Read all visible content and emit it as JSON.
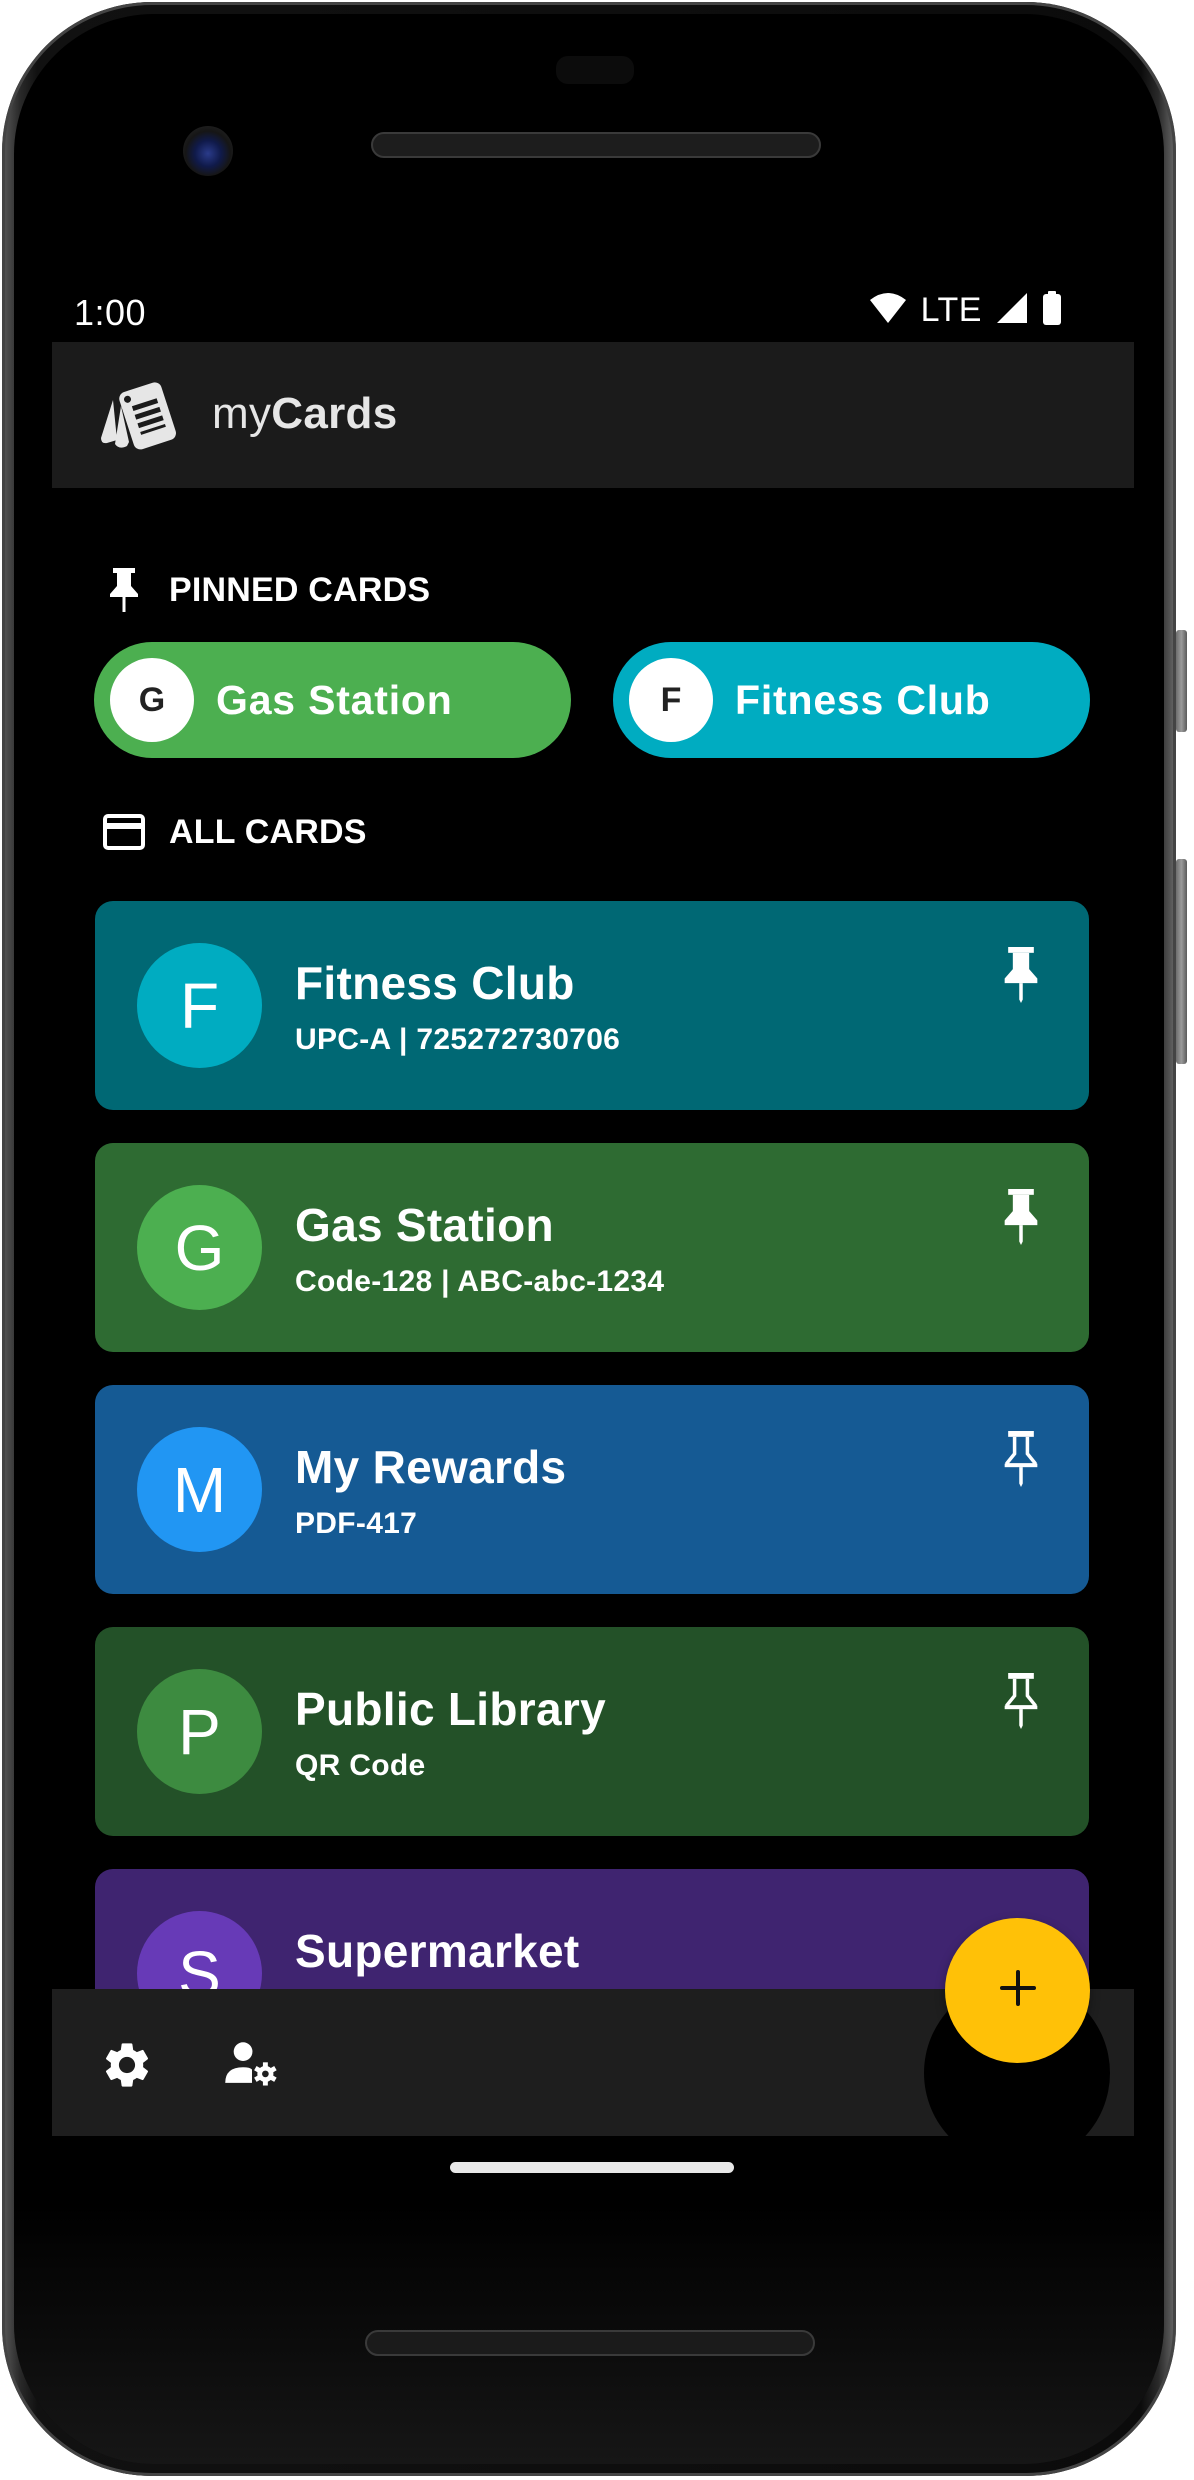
{
  "status_bar": {
    "time": "1:00",
    "network": "LTE",
    "icons": [
      "wifi-icon",
      "cellular-signal-icon",
      "battery-icon"
    ]
  },
  "app_bar": {
    "logo_icon": "cards-logo-icon",
    "title_prefix": "my",
    "title_main": "Cards"
  },
  "pinned_section": {
    "icon": "pin-icon",
    "label": "PINNED CARDS",
    "chips": [
      {
        "initial": "G",
        "label": "Gas Station",
        "color": "#4caf50"
      },
      {
        "initial": "F",
        "label": "Fitness Club",
        "color": "#00acc1"
      }
    ]
  },
  "all_section": {
    "icon": "credit-card-icon",
    "label": "ALL CARDS",
    "cards": [
      {
        "initial": "F",
        "title": "Fitness Club",
        "subtitle": "UPC-A | 725272730706",
        "pinned": true,
        "bg": "#006874",
        "avatar_bg": "#00acc1"
      },
      {
        "initial": "G",
        "title": "Gas Station",
        "subtitle": "Code-128 | ABC-abc-1234",
        "pinned": true,
        "bg": "#2e6b32",
        "avatar_bg": "#4caf50"
      },
      {
        "initial": "M",
        "title": "My Rewards",
        "subtitle": "PDF-417",
        "pinned": false,
        "bg": "#155a94",
        "avatar_bg": "#2196f3"
      },
      {
        "initial": "P",
        "title": "Public Library",
        "subtitle": "QR Code",
        "pinned": false,
        "bg": "#235128",
        "avatar_bg": "#3d8b40"
      },
      {
        "initial": "S",
        "title": "Supermarket",
        "subtitle": "",
        "pinned": false,
        "bg": "#3f2470",
        "avatar_bg": "#673ab7"
      }
    ]
  },
  "bottom_bar": {
    "items": [
      {
        "icon": "settings-icon",
        "label": "Settings"
      },
      {
        "icon": "manage-accounts-icon",
        "label": "Account settings"
      }
    ],
    "fab": {
      "icon": "plus-icon",
      "label": "Add card",
      "color": "#ffc107"
    }
  }
}
